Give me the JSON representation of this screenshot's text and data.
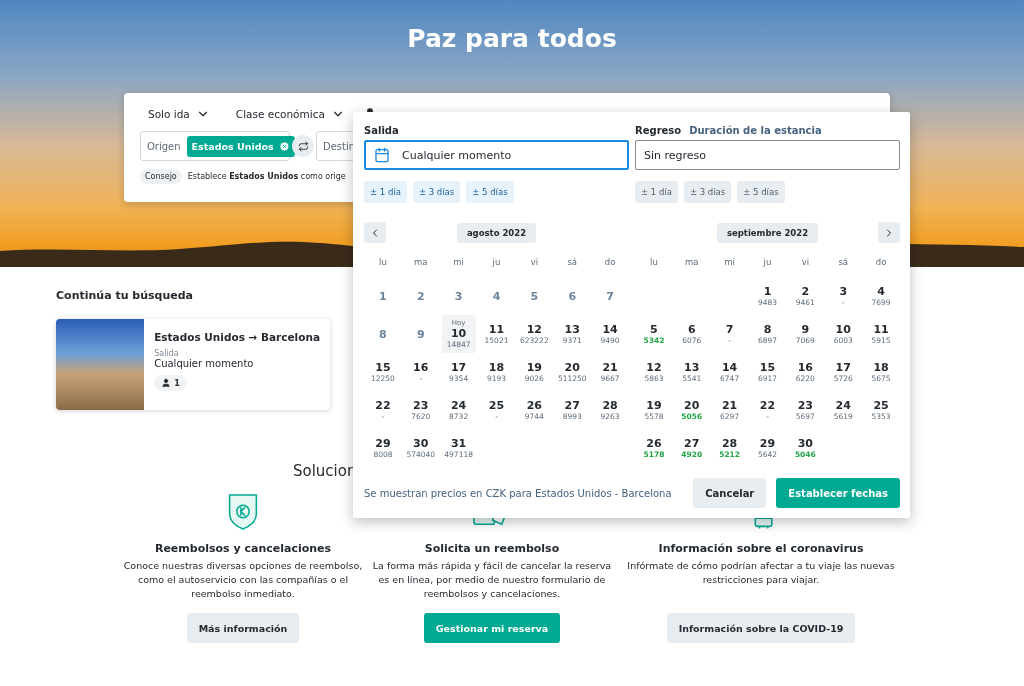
{
  "hero": {
    "title": "Paz para todos"
  },
  "search": {
    "trip_type": "Solo ida",
    "cabin_class": "Clase económica",
    "origin_label": "Origen",
    "origin_chip": "Estados Unidos",
    "destination_label": "Destin",
    "tip_tag": "Consejo",
    "tip_text": "Establece **Estados Unidos** como orige"
  },
  "date_picker": {
    "departure": {
      "label": "Salida",
      "value": "Cualquier momento",
      "focused": true,
      "flex_disabled": false,
      "flex": [
        "± 1 día",
        "± 3 días",
        "± 5 días"
      ]
    },
    "return": {
      "label": "Regreso",
      "link": "Duración de la estancia",
      "value": "Sin regreso",
      "focused": false,
      "flex_disabled": true,
      "flex": [
        "± 1 día",
        "± 3 días",
        "± 5 días"
      ]
    },
    "months": [
      {
        "title": "agosto 2022",
        "weekdays": [
          "lu",
          "ma",
          "mi",
          "ju",
          "vi",
          "sá",
          "do"
        ],
        "weeks": [
          [
            {
              "day": "1",
              "kind": "past"
            },
            {
              "day": "2",
              "kind": "past"
            },
            {
              "day": "3",
              "kind": "past"
            },
            {
              "day": "4",
              "kind": "past"
            },
            {
              "day": "5",
              "kind": "past"
            },
            {
              "day": "6",
              "kind": "past"
            },
            {
              "day": "7",
              "kind": "past"
            }
          ],
          [
            {
              "day": "8",
              "kind": "past"
            },
            {
              "day": "9",
              "kind": "past"
            },
            {
              "day": "10",
              "kind": "today",
              "note": "Hoy",
              "price": "14847",
              "cheap": false
            },
            {
              "day": "11",
              "kind": "day",
              "price": "15021",
              "cheap": false
            },
            {
              "day": "12",
              "kind": "day",
              "price": "623222",
              "cheap": false
            },
            {
              "day": "13",
              "kind": "day",
              "price": "9371",
              "cheap": false
            },
            {
              "day": "14",
              "kind": "day",
              "price": "9490",
              "cheap": false
            }
          ],
          [
            {
              "day": "15",
              "kind": "day",
              "price": "12250",
              "cheap": false
            },
            {
              "day": "16",
              "kind": "day",
              "price": "-",
              "cheap": false
            },
            {
              "day": "17",
              "kind": "day",
              "price": "9354",
              "cheap": false
            },
            {
              "day": "18",
              "kind": "day",
              "price": "9193",
              "cheap": false
            },
            {
              "day": "19",
              "kind": "day",
              "price": "9026",
              "cheap": false
            },
            {
              "day": "20",
              "kind": "day",
              "price": "511250",
              "cheap": false
            },
            {
              "day": "21",
              "kind": "day",
              "price": "9667",
              "cheap": false
            }
          ],
          [
            {
              "day": "22",
              "kind": "day",
              "price": "-",
              "cheap": false
            },
            {
              "day": "23",
              "kind": "day",
              "price": "7620",
              "cheap": false
            },
            {
              "day": "24",
              "kind": "day",
              "price": "8732",
              "cheap": false
            },
            {
              "day": "25",
              "kind": "day",
              "price": "-",
              "cheap": false
            },
            {
              "day": "26",
              "kind": "day",
              "price": "9744",
              "cheap": false
            },
            {
              "day": "27",
              "kind": "day",
              "price": "8993",
              "cheap": false
            },
            {
              "day": "28",
              "kind": "day",
              "price": "9263",
              "cheap": false
            }
          ],
          [
            {
              "day": "29",
              "kind": "day",
              "price": "8008",
              "cheap": false
            },
            {
              "day": "30",
              "kind": "day",
              "price": "574040",
              "cheap": false
            },
            {
              "day": "31",
              "kind": "day",
              "price": "497118",
              "cheap": false
            }
          ]
        ]
      },
      {
        "title": "septiembre 2022",
        "weekdays": [
          "lu",
          "ma",
          "mi",
          "ju",
          "vi",
          "sá",
          "do"
        ],
        "weeks": [
          [
            {
              "day": "1",
              "kind": "day",
              "price": "9483",
              "cheap": false
            },
            {
              "day": "2",
              "kind": "day",
              "price": "9461",
              "cheap": false
            },
            {
              "day": "3",
              "kind": "day",
              "price": "-",
              "cheap": false
            },
            {
              "day": "4",
              "kind": "day",
              "price": "7699",
              "cheap": false
            }
          ],
          [
            {
              "day": "5",
              "kind": "day",
              "price": "5342",
              "cheap": true
            },
            {
              "day": "6",
              "kind": "day",
              "price": "6076",
              "cheap": false
            },
            {
              "day": "7",
              "kind": "day",
              "price": "-",
              "cheap": false
            },
            {
              "day": "8",
              "kind": "day",
              "price": "6897",
              "cheap": false
            },
            {
              "day": "9",
              "kind": "day",
              "price": "7069",
              "cheap": false
            },
            {
              "day": "10",
              "kind": "day",
              "price": "6003",
              "cheap": false
            },
            {
              "day": "11",
              "kind": "day",
              "price": "5915",
              "cheap": false
            }
          ],
          [
            {
              "day": "12",
              "kind": "day",
              "price": "5863",
              "cheap": false
            },
            {
              "day": "13",
              "kind": "day",
              "price": "5541",
              "cheap": false
            },
            {
              "day": "14",
              "kind": "day",
              "price": "6747",
              "cheap": false
            },
            {
              "day": "15",
              "kind": "day",
              "price": "6917",
              "cheap": false
            },
            {
              "day": "16",
              "kind": "day",
              "price": "6220",
              "cheap": false
            },
            {
              "day": "17",
              "kind": "day",
              "price": "5726",
              "cheap": false
            },
            {
              "day": "18",
              "kind": "day",
              "price": "5675",
              "cheap": false
            }
          ],
          [
            {
              "day": "19",
              "kind": "day",
              "price": "5578",
              "cheap": false
            },
            {
              "day": "20",
              "kind": "day",
              "price": "5056",
              "cheap": true
            },
            {
              "day": "21",
              "kind": "day",
              "price": "6297",
              "cheap": false
            },
            {
              "day": "22",
              "kind": "day",
              "price": "-",
              "cheap": false
            },
            {
              "day": "23",
              "kind": "day",
              "price": "5697",
              "cheap": false
            },
            {
              "day": "24",
              "kind": "day",
              "price": "5619",
              "cheap": false
            },
            {
              "day": "25",
              "kind": "day",
              "price": "5353",
              "cheap": false
            }
          ],
          [
            {
              "day": "26",
              "kind": "day",
              "price": "5178",
              "cheap": true
            },
            {
              "day": "27",
              "kind": "day",
              "price": "4920",
              "cheap": true
            },
            {
              "day": "28",
              "kind": "day",
              "price": "5212",
              "cheap": true
            },
            {
              "day": "29",
              "kind": "day",
              "price": "5642",
              "cheap": false
            },
            {
              "day": "30",
              "kind": "day",
              "price": "5046",
              "cheap": true
            }
          ]
        ]
      }
    ],
    "currency_note": "Se muestran precios en CZK para Estados Unidos - Barcelona",
    "cancel_button": "Cancelar",
    "confirm_button": "Establecer fechas"
  },
  "recent": {
    "heading": "Continúa tu búsqueda",
    "route": "Estados Unidos → Barcelona",
    "date_label": "Salida",
    "date_value": "Cualquier momento",
    "passengers": "1"
  },
  "solutions": {
    "heading": "Solucion",
    "items": [
      {
        "kind": "shield",
        "title": "Reembolsos y cancelaciones",
        "text": "Conoce nuestras diversas opciones de reembolso, como el autoservicio con las compañías o el reembolso inmediato.",
        "button": "Más información",
        "primary": false
      },
      {
        "kind": "cards",
        "title": "Solicita un reembolso",
        "text": "La forma más rápida y fácil de cancelar la reserva es en línea, por medio de nuestro formulario de reembolsos y cancelaciones.",
        "button": "Gestionar mi reserva",
        "primary": true
      },
      {
        "kind": "travel",
        "title": "Información sobre el coronavirus",
        "text": "Infórmate de cómo podrían afectar a tu viaje las nuevas restricciones para viajar.",
        "button": "Información sobre la COVID-19",
        "primary": false
      }
    ]
  }
}
